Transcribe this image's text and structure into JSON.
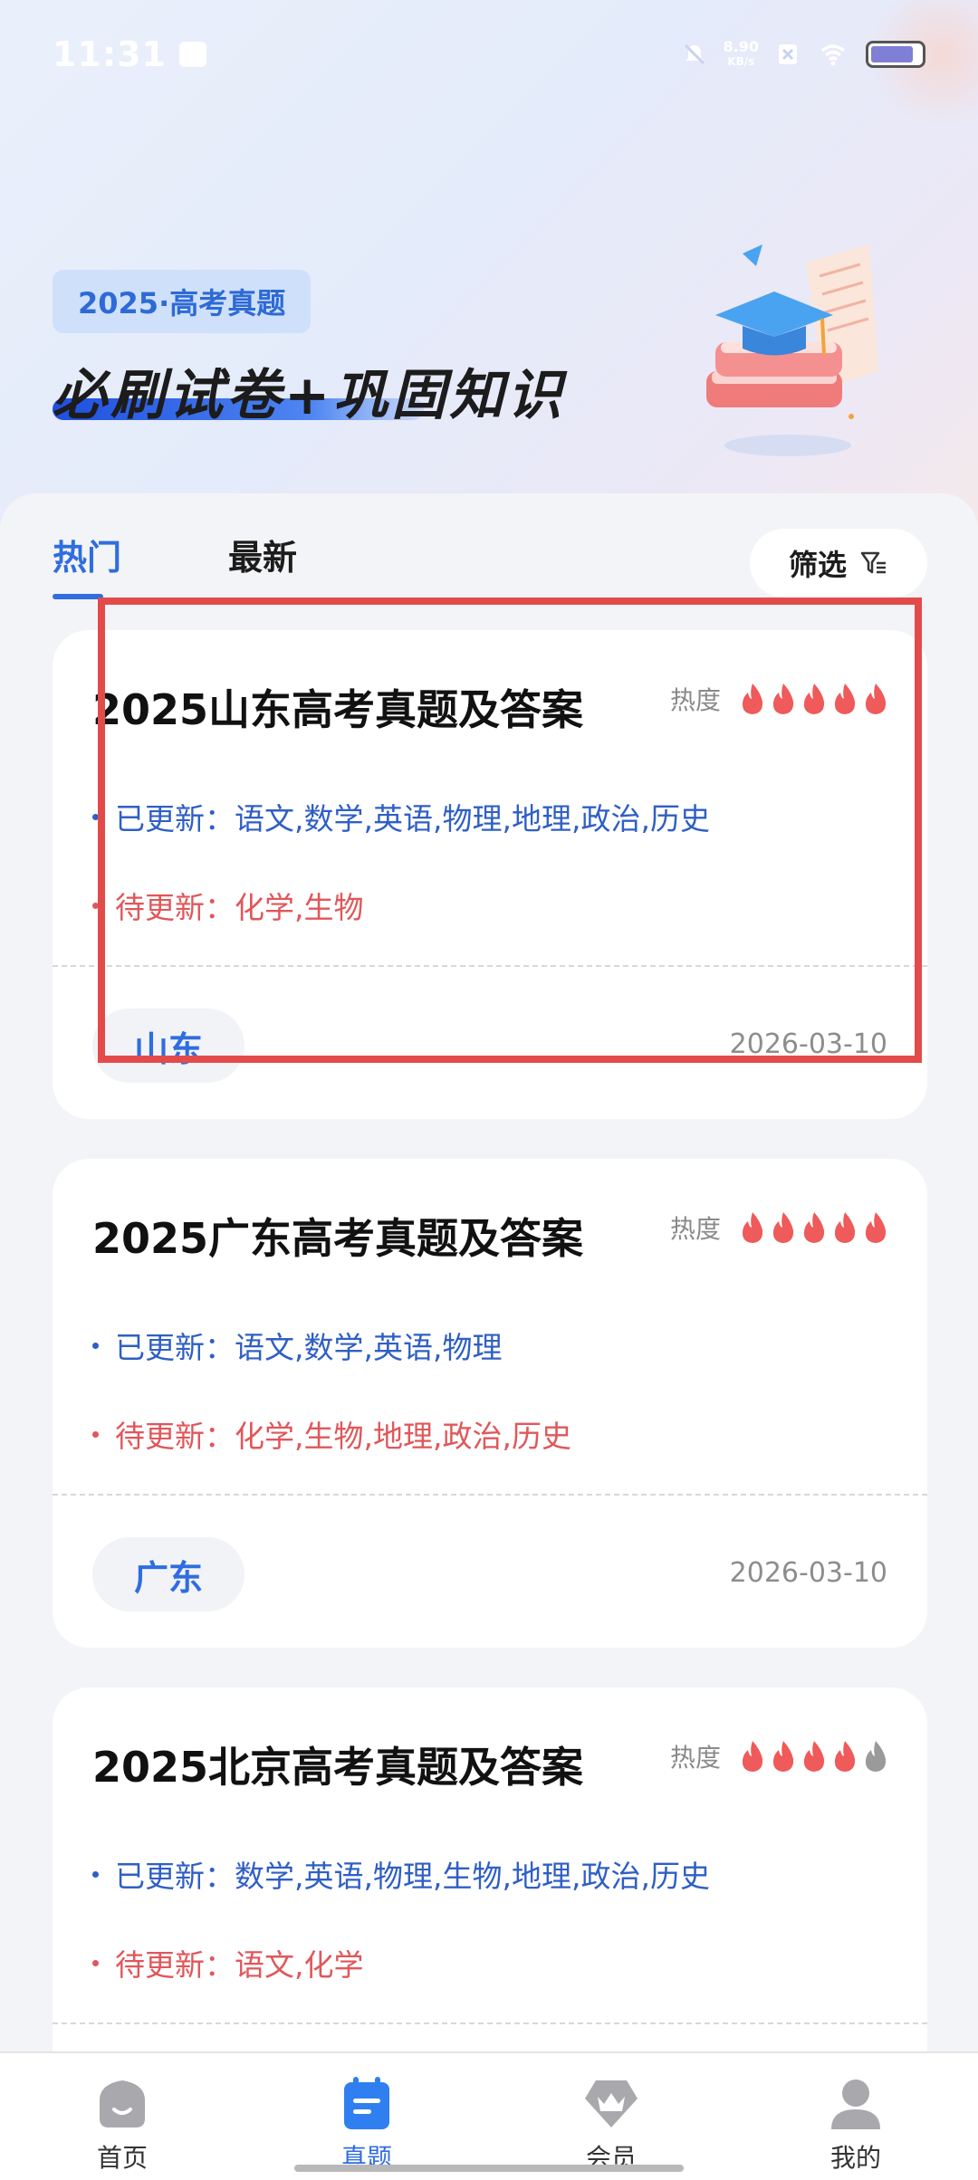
{
  "status_bar": {
    "time": "11:31",
    "net_speed_value": "8.90",
    "net_speed_unit": "KB/s"
  },
  "banner": {
    "badge": "2025·高考真题",
    "headline": "必刷试卷+巩固知识"
  },
  "tabs": [
    {
      "label": "热门",
      "active": true
    },
    {
      "label": "最新",
      "active": false
    }
  ],
  "filter": {
    "label": "筛选"
  },
  "cards": [
    {
      "title": "2025山东高考真题及答案",
      "heat_label": "热度",
      "heat_level": 5,
      "updated_label": "已更新：",
      "updated_subjects": "语文,数学,英语,物理,地理,政治,历史",
      "pending_label": "待更新：",
      "pending_subjects": "化学,生物",
      "region": "山东",
      "date": "2026-03-10"
    },
    {
      "title": "2025广东高考真题及答案",
      "heat_label": "热度",
      "heat_level": 5,
      "updated_label": "已更新：",
      "updated_subjects": "语文,数学,英语,物理",
      "pending_label": "待更新：",
      "pending_subjects": "化学,生物,地理,政治,历史",
      "region": "广东",
      "date": "2026-03-10"
    },
    {
      "title": "2025北京高考真题及答案",
      "heat_label": "热度",
      "heat_level": 4,
      "updated_label": "已更新：",
      "updated_subjects": "数学,英语,物理,生物,地理,政治,历史",
      "pending_label": "待更新：",
      "pending_subjects": "语文,化学"
    }
  ],
  "bottom_nav": [
    {
      "label": "首页",
      "icon": "home-icon",
      "active": false
    },
    {
      "label": "真题",
      "icon": "exam-icon",
      "active": true
    },
    {
      "label": "会员",
      "icon": "vip-crown-icon",
      "active": false
    },
    {
      "label": "我的",
      "icon": "profile-icon",
      "active": false
    }
  ],
  "colors": {
    "accent": "#2f6de0",
    "updated": "#2f5fc4",
    "pending": "#e0575a",
    "flame_active": "#ef5a5a",
    "flame_inactive": "#9a9a9a",
    "highlight": "#e34b4b"
  }
}
